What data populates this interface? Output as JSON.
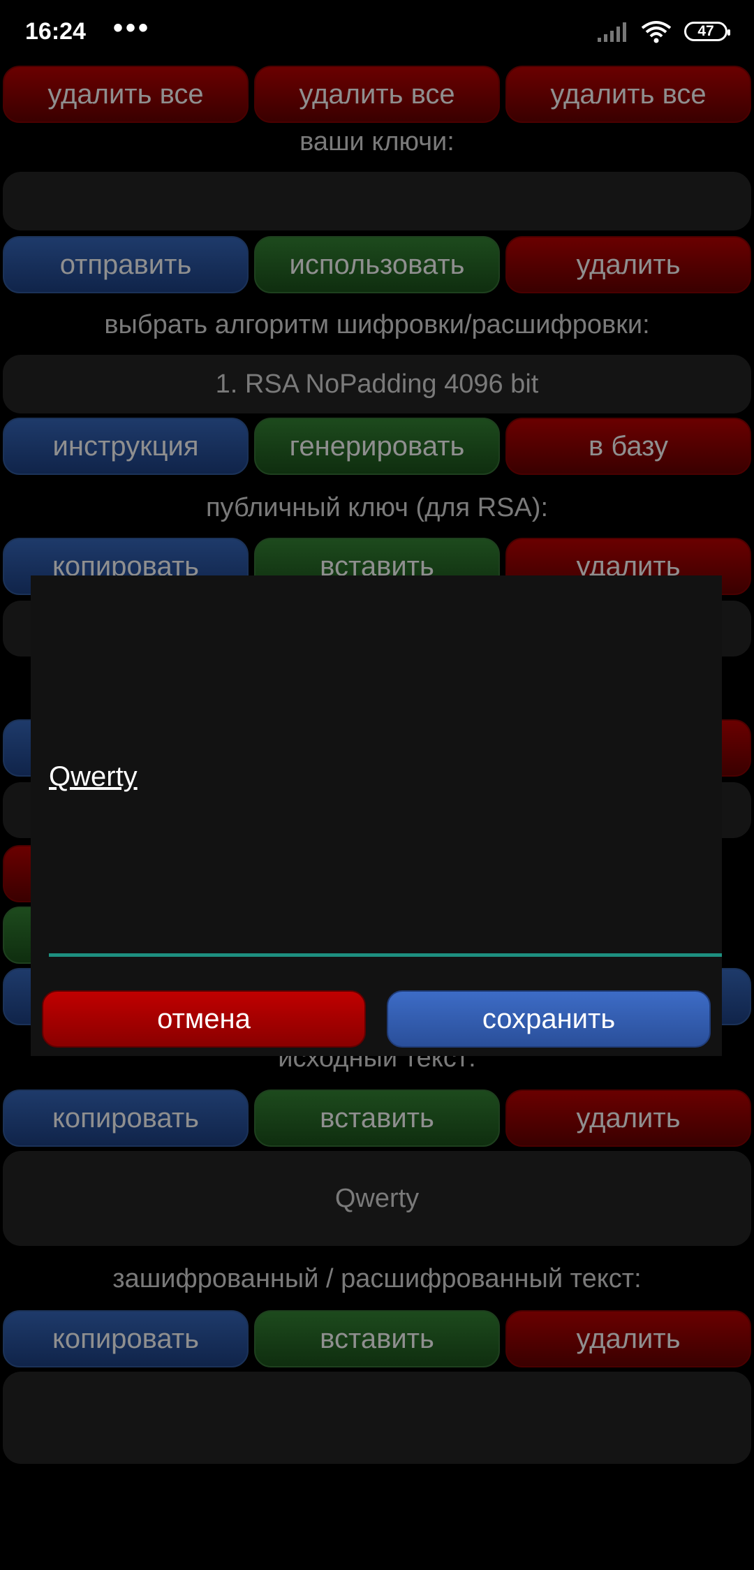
{
  "status_bar": {
    "time": "16:24",
    "dots": "•••",
    "battery": "47"
  },
  "rows": {
    "r0": [
      "удалить все",
      "удалить все",
      "удалить все"
    ],
    "r1": [
      "отправить",
      "использовать",
      "удалить"
    ],
    "r2": [
      "инструкция",
      "генерировать",
      "в базу"
    ],
    "r3": [
      "копировать",
      "вставить",
      "удалить"
    ],
    "r4": [
      "копировать",
      "вставить",
      "удалить"
    ],
    "r5": [
      "копировать",
      "вставить",
      "удалить"
    ]
  },
  "labels": {
    "keys": "ваши ключи:",
    "algo": "выбрать алгоритм шифровки/расшифровки:",
    "pubkey": "публичный ключ (для RSA):",
    "source": "исходный текст:",
    "result": "зашифрованный / расшифрованный текст:"
  },
  "fields": {
    "keys": "",
    "algo": "1. RSA NoPadding 4096 bit",
    "source": "Qwerty",
    "result": ""
  },
  "dialog": {
    "input_value": "Qwerty",
    "cancel": "отмена",
    "save": "сохранить"
  },
  "colors": {
    "accent_underline": "#1e9080",
    "cancel": "#c00000",
    "save": "#3d6cc6"
  }
}
